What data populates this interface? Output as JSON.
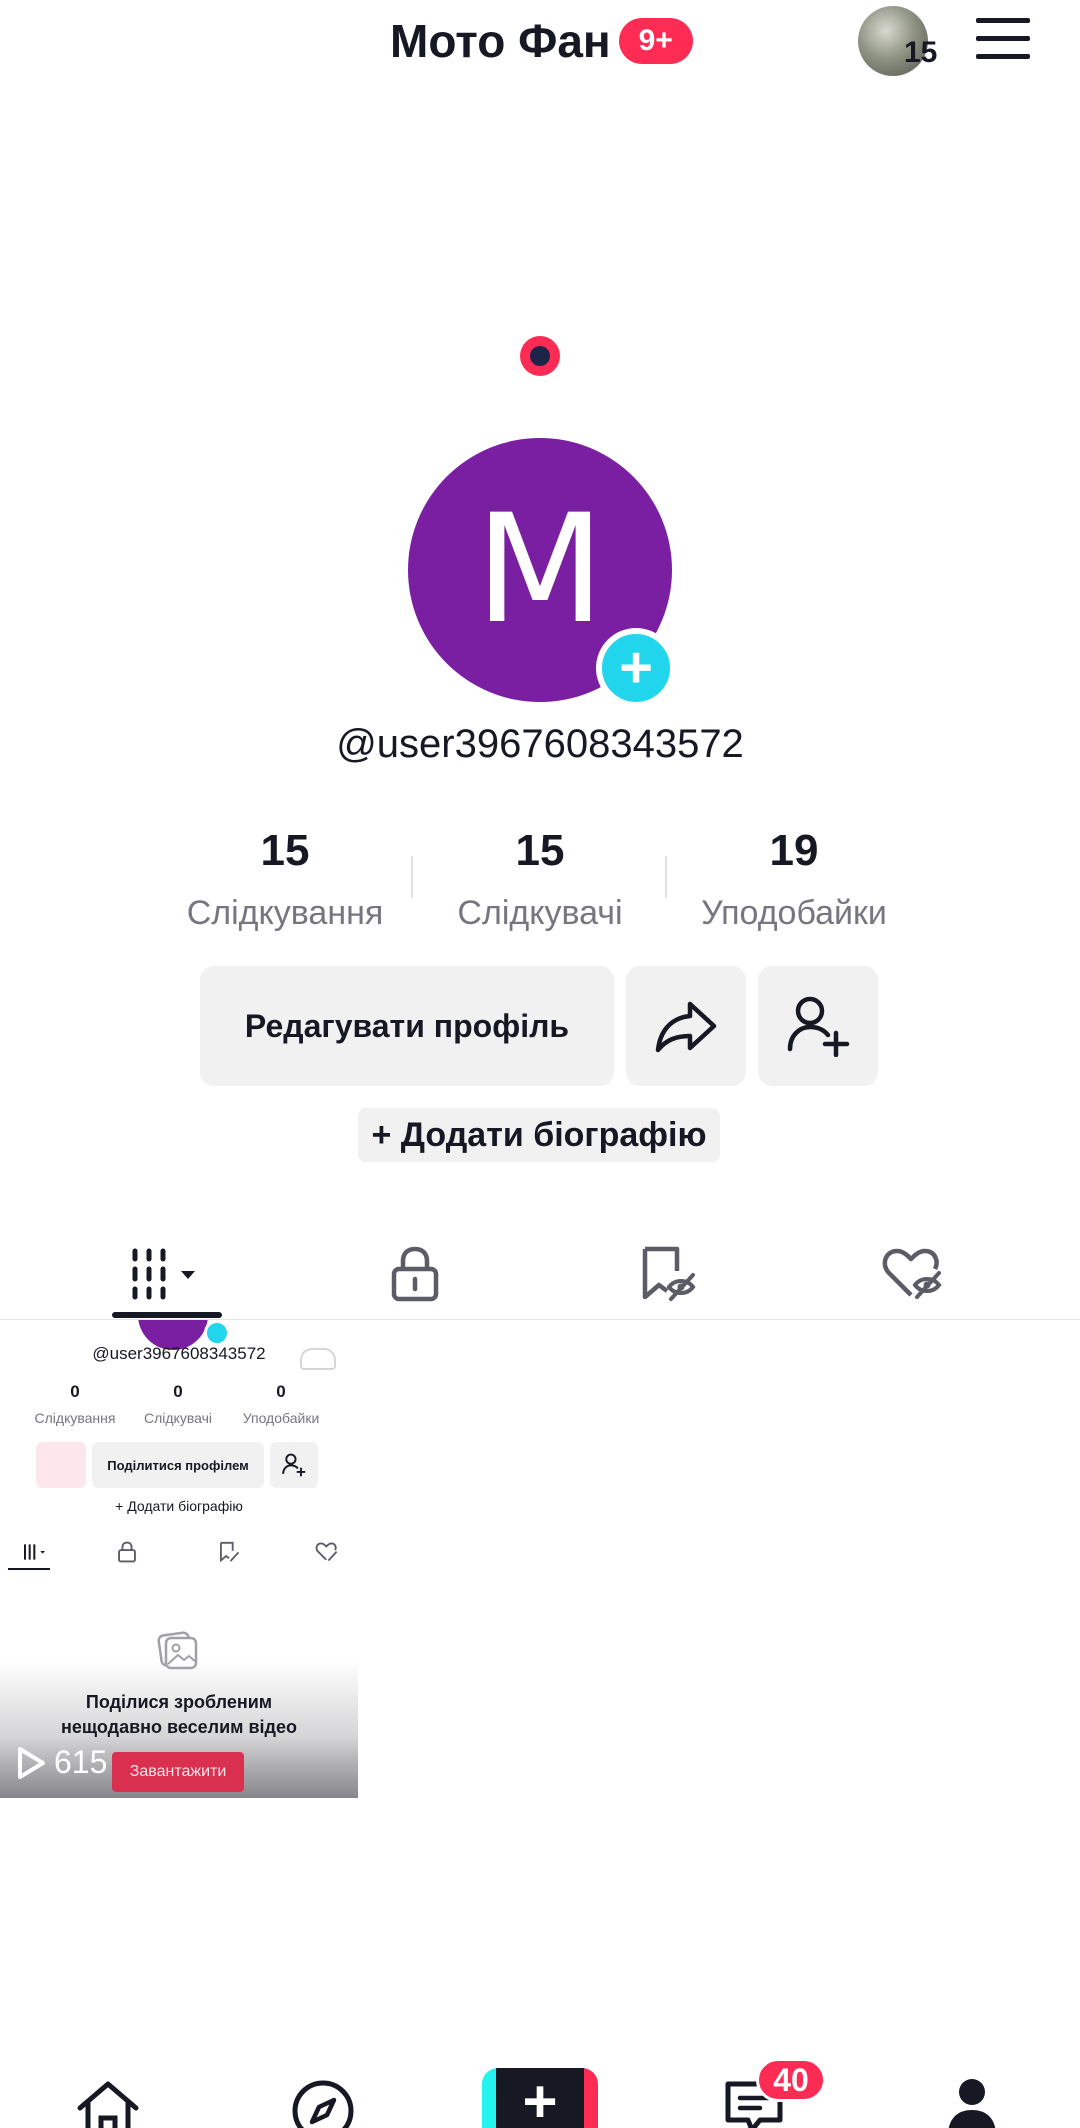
{
  "header": {
    "title": "Мото Фан",
    "title_badge": "9+",
    "story_count": "15"
  },
  "profile": {
    "avatar_letter": "M",
    "avatar_color": "#7b1fa2",
    "username": "@user3967608343572",
    "stats": [
      {
        "value": "15",
        "label": "Слідкування"
      },
      {
        "value": "15",
        "label": "Слідкувачі"
      },
      {
        "value": "19",
        "label": "Уподобайки"
      }
    ],
    "edit_button": "Редагувати профіль",
    "add_bio": "+ Додати біографію"
  },
  "tabs": [
    {
      "icon": "grid-icon",
      "active": true
    },
    {
      "icon": "lock-icon",
      "active": false
    },
    {
      "icon": "saved-hidden-icon",
      "active": false
    },
    {
      "icon": "liked-hidden-icon",
      "active": false
    }
  ],
  "video": {
    "views": "615",
    "preview": {
      "username": "@user3967608343572",
      "stats": [
        {
          "value": "0",
          "label": "Слідкування"
        },
        {
          "value": "0",
          "label": "Слідкувачі"
        },
        {
          "value": "0",
          "label": "Уподобайки"
        }
      ],
      "share_button": "Поділитися профілем",
      "add_bio": "+ Додати біографію",
      "prompt_line1": "Поділися зробленим",
      "prompt_line2": "нещодавно веселим відео",
      "upload_button": "Завантажити"
    }
  },
  "bottom_nav": {
    "inbox_badge": "40"
  },
  "colors": {
    "accent": "#fe2c55",
    "cyan": "#20d5ec",
    "text": "#161823",
    "secondary_text": "#767680"
  }
}
